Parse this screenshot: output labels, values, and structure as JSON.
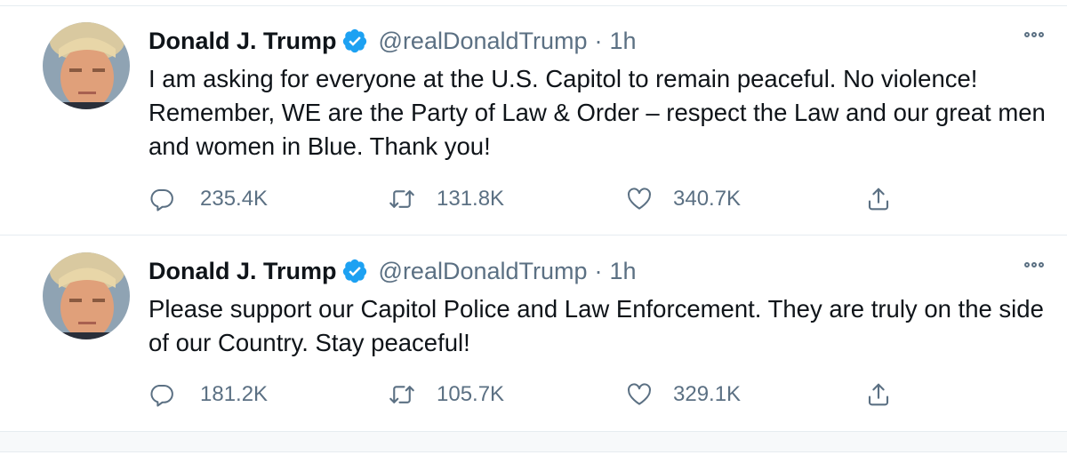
{
  "tweets": [
    {
      "author_name": "Donald J. Trump",
      "handle": "@realDonaldTrump",
      "separator": "·",
      "time": "1h",
      "text": "I am asking for everyone at the U.S. Capitol to remain peaceful. No violence! Remember, WE are the Party of Law & Order – respect the Law and our great men and women in Blue. Thank you!",
      "replies": "235.4K",
      "retweets": "131.8K",
      "likes": "340.7K"
    },
    {
      "author_name": "Donald J. Trump",
      "handle": "@realDonaldTrump",
      "separator": "·",
      "time": "1h",
      "text": "Please support our Capitol Police and Law Enforcement. They are truly on the side of our Country. Stay peaceful!",
      "replies": "181.2K",
      "retweets": "105.7K",
      "likes": "329.1K"
    }
  ],
  "icons": {
    "reply": "reply-icon",
    "retweet": "retweet-icon",
    "like": "like-icon",
    "share": "share-icon",
    "verified": "verified-badge-icon",
    "more": "more-icon"
  },
  "colors": {
    "text": "#0f1419",
    "secondary": "#5b7083",
    "verified_blue": "#1da1f2",
    "divider": "#e6ecf0"
  }
}
